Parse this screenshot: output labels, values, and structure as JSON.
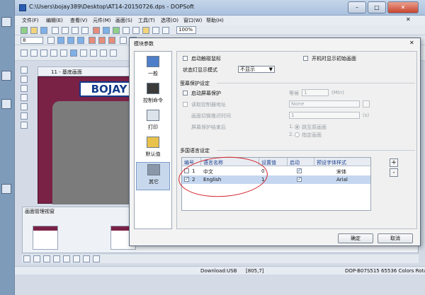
{
  "window": {
    "title": "C:\\Users\\bojay389\\Desktop\\AT14-20150726.dps - DOPSoft",
    "min": "–",
    "max": "□",
    "close": "✕"
  },
  "menu": {
    "items": [
      "文件(F)",
      "编辑(E)",
      "查看(V)",
      "元件(M)",
      "画面(S)",
      "工具(T)",
      "选项(O)",
      "窗口(W)",
      "帮助(H)"
    ],
    "close_x": "✕"
  },
  "toolbar": {
    "font_size": "8",
    "zoom": "100%"
  },
  "screen": {
    "tab_label": "11 - 基底画面",
    "logo_text": "BOJAY"
  },
  "screen_manager": {
    "title": "画面管理视窗"
  },
  "status": {
    "download": "Download:USB",
    "coords": "[805,7]",
    "device": "DOP-B07S515 65536 Colors Rotate 0 d"
  },
  "dialog": {
    "title": "模块参数",
    "close": "✕",
    "nav": [
      {
        "label": "一般",
        "icon": "general-settings-icon"
      },
      {
        "label": "控制命令",
        "icon": "control-command-icon"
      },
      {
        "label": "打印",
        "icon": "printer-icon"
      },
      {
        "label": "默认值",
        "icon": "default-value-icon"
      },
      {
        "label": "其它",
        "icon": "tools-icon"
      }
    ],
    "options": {
      "touch_cursor": "启动触碰鼠标",
      "show_init_screen": "开机时显示初始画面",
      "status_light_label": "状态灯显示模式",
      "status_light_value": "不显示"
    },
    "screensaver": {
      "group_title": "萤幕保护设定",
      "enable": "启动屏幕保护",
      "wait_label": "等候",
      "wait_value": "1",
      "wait_unit": "(Min)",
      "read_control_addr": "读取控制器地址",
      "addr_value": "None",
      "interval_label": "画面切换推迟时间",
      "interval_value": "1",
      "interval_unit": "(s)",
      "end_label": "屏幕保护结束后",
      "end_option_1_num": "1.",
      "end_option_1": "跳至原画面",
      "end_option_2_num": "2.",
      "end_option_2": "指定画面"
    },
    "multilang": {
      "group_title": "多国语言设定",
      "columns": [
        "编号",
        "语言名称",
        "设置值",
        "启动",
        "预设字体样式"
      ],
      "rows": [
        {
          "num": "1",
          "name": "中文",
          "value": "0",
          "font": "宋体"
        },
        {
          "num": "2",
          "name": "English",
          "value": "1",
          "font": "Arial"
        }
      ],
      "add": "+",
      "remove": "-"
    },
    "buttons": {
      "ok": "确定",
      "cancel": "取消"
    }
  },
  "colors": {
    "desktop": "#8fa9c4",
    "canvas_bg": "#7a2146",
    "selection": "#c5d7f0",
    "annotation": "#d2232a"
  }
}
